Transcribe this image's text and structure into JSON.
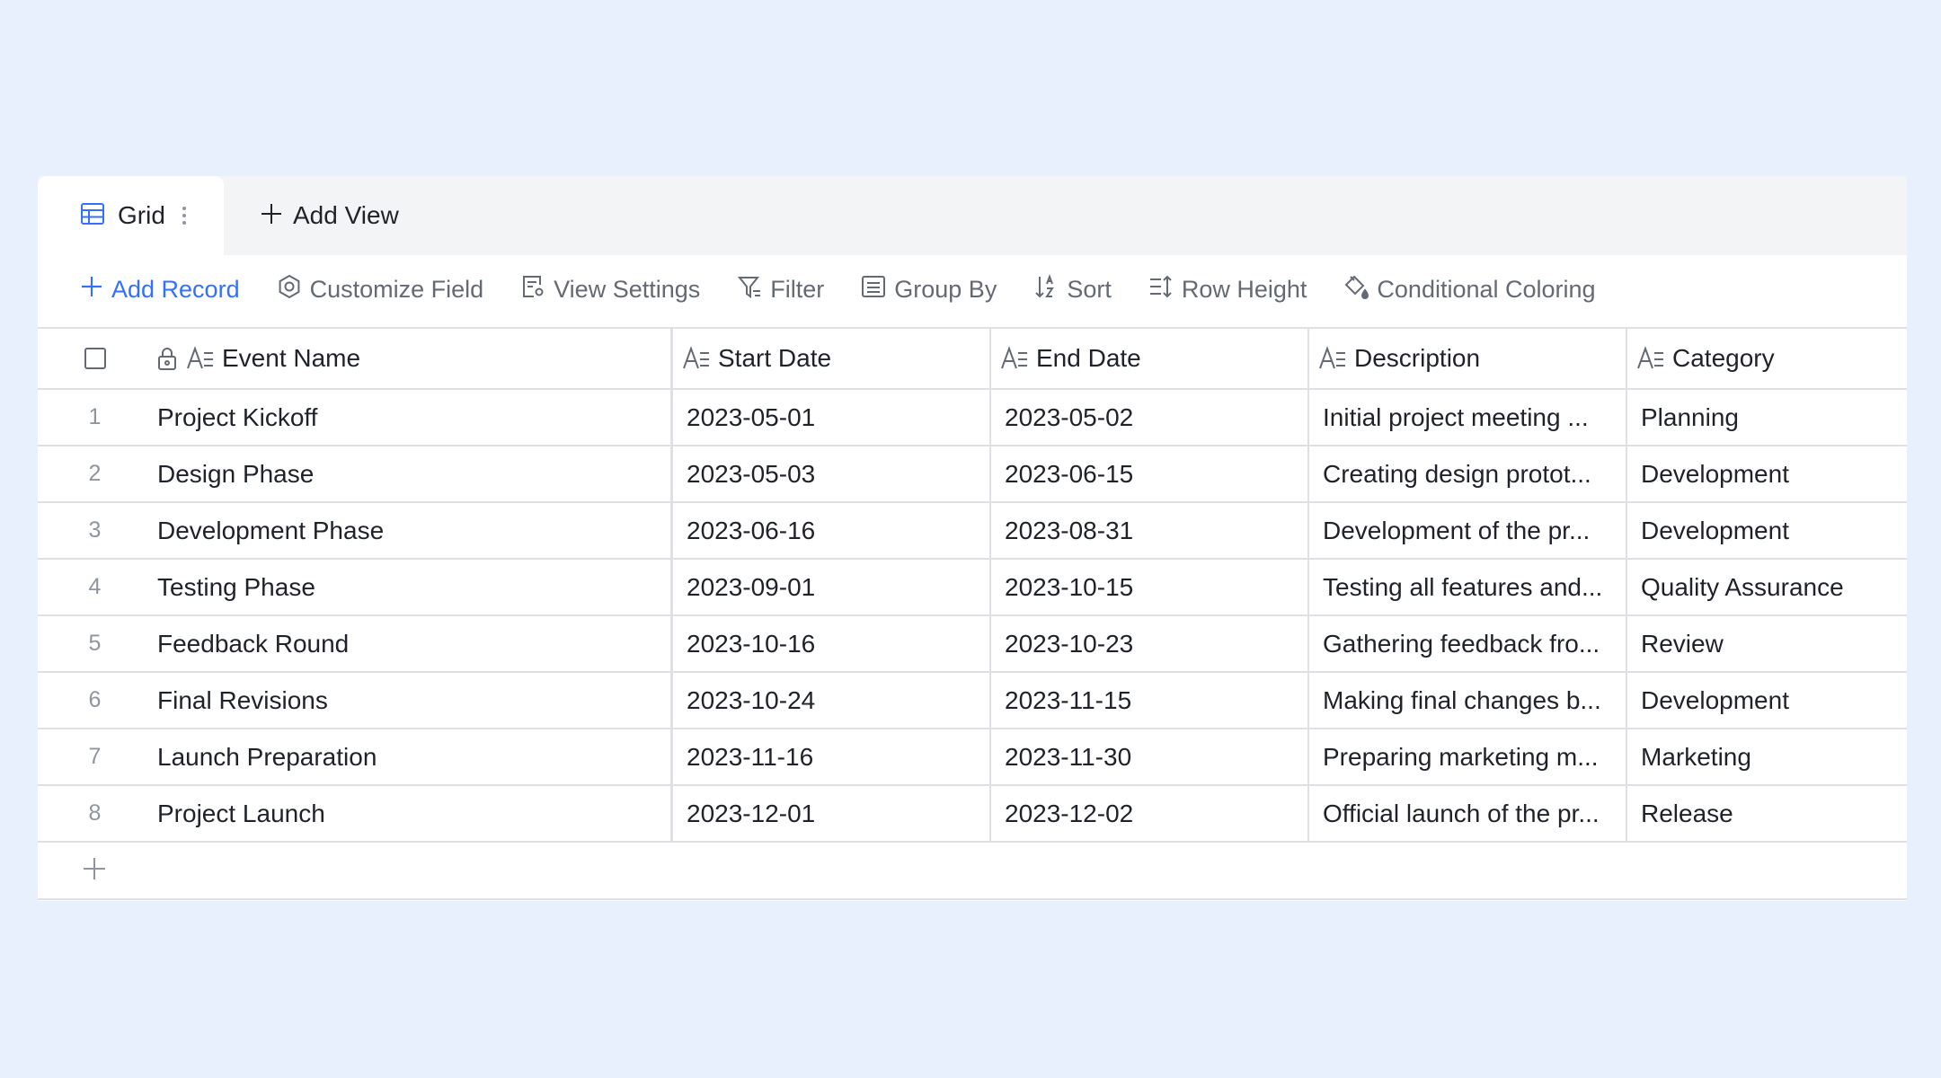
{
  "tabs": {
    "grid_label": "Grid",
    "add_view_label": "Add View"
  },
  "toolbar": {
    "add_record": "Add Record",
    "customize_field": "Customize Field",
    "view_settings": "View Settings",
    "filter": "Filter",
    "group_by": "Group By",
    "sort": "Sort",
    "row_height": "Row Height",
    "conditional_coloring": "Conditional Coloring"
  },
  "columns": {
    "event_name": "Event Name",
    "start_date": "Start Date",
    "end_date": "End Date",
    "description": "Description",
    "category": "Category"
  },
  "rows": [
    {
      "num": "1",
      "name": "Project Kickoff",
      "start": "2023-05-01",
      "end": "2023-05-02",
      "desc": "Initial project meeting ...",
      "cat": "Planning"
    },
    {
      "num": "2",
      "name": "Design Phase",
      "start": "2023-05-03",
      "end": "2023-06-15",
      "desc": "Creating design protot...",
      "cat": "Development"
    },
    {
      "num": "3",
      "name": "Development Phase",
      "start": "2023-06-16",
      "end": "2023-08-31",
      "desc": "Development of the pr...",
      "cat": "Development"
    },
    {
      "num": "4",
      "name": "Testing Phase",
      "start": "2023-09-01",
      "end": "2023-10-15",
      "desc": "Testing all features and...",
      "cat": "Quality Assurance"
    },
    {
      "num": "5",
      "name": "Feedback Round",
      "start": "2023-10-16",
      "end": "2023-10-23",
      "desc": "Gathering feedback fro...",
      "cat": "Review"
    },
    {
      "num": "6",
      "name": "Final Revisions",
      "start": "2023-10-24",
      "end": "2023-11-15",
      "desc": "Making final changes b...",
      "cat": "Development"
    },
    {
      "num": "7",
      "name": "Launch Preparation",
      "start": "2023-11-16",
      "end": "2023-11-30",
      "desc": "Preparing marketing m...",
      "cat": "Marketing"
    },
    {
      "num": "8",
      "name": "Project Launch",
      "start": "2023-12-01",
      "end": "2023-12-02",
      "desc": "Official launch of the pr...",
      "cat": "Release"
    }
  ],
  "icons": {
    "grid_view": "grid-view-icon",
    "more": "more-vertical-icon",
    "plus": "plus-icon",
    "gear": "gear-icon",
    "view_settings": "view-settings-icon",
    "filter": "filter-icon",
    "group_by": "group-by-icon",
    "sort": "sort-icon",
    "row_height": "row-height-icon",
    "paint_bucket": "paint-bucket-icon",
    "lock": "lock-icon",
    "text_field": "text-field-icon"
  },
  "colors": {
    "accent": "#3370ff",
    "background": "#e9f0fd",
    "muted_text": "#646a73"
  }
}
